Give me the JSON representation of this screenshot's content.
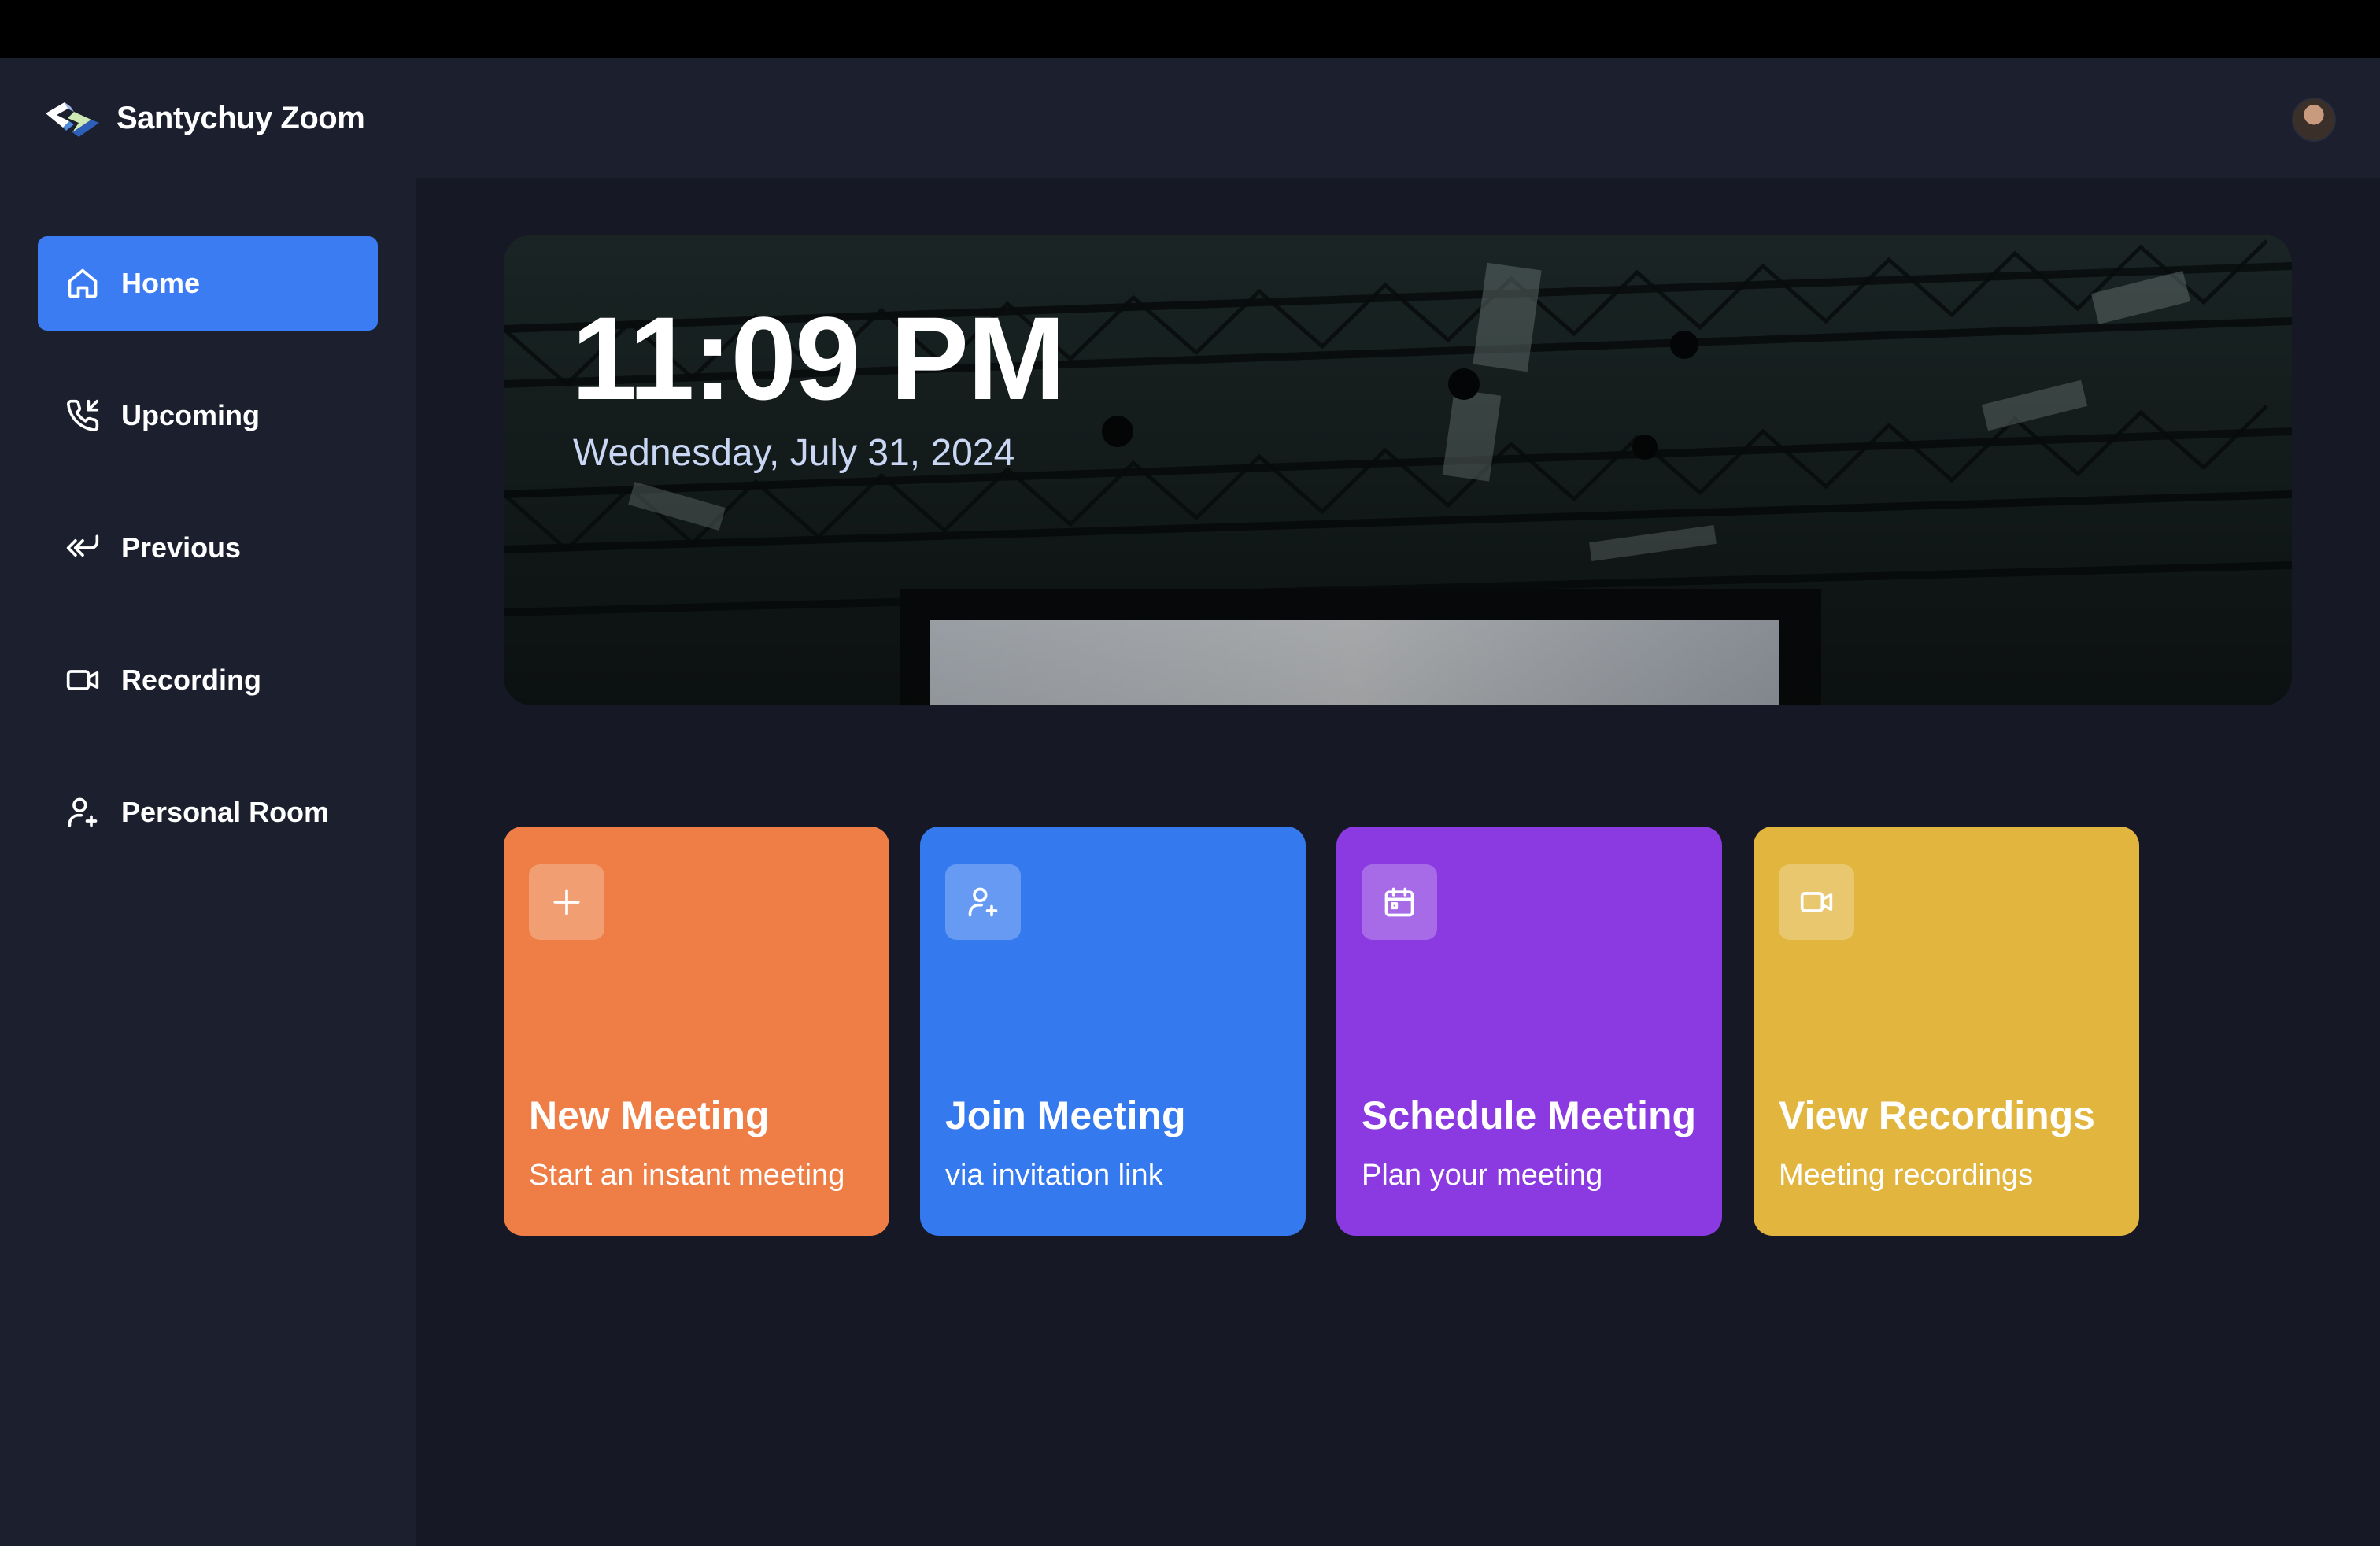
{
  "app": {
    "title": "Santychuy Zoom",
    "logo_icon": "zoom-logo-icon",
    "avatar_icon": "user-avatar"
  },
  "sidebar": {
    "items": [
      {
        "label": "Home",
        "icon": "home-icon",
        "active": true
      },
      {
        "label": "Upcoming",
        "icon": "phone-incoming-icon",
        "active": false
      },
      {
        "label": "Previous",
        "icon": "reply-arrow-icon",
        "active": false
      },
      {
        "label": "Recording",
        "icon": "video-icon",
        "active": false
      },
      {
        "label": "Personal Room",
        "icon": "user-plus-icon",
        "active": false
      }
    ]
  },
  "hero": {
    "time": "11:09 PM",
    "date": "Wednesday, July 31, 2024"
  },
  "cards": [
    {
      "title": "New Meeting",
      "subtitle": "Start an instant meeting",
      "icon": "plus-icon",
      "color": "#ee7e45"
    },
    {
      "title": "Join Meeting",
      "subtitle": "via invitation link",
      "icon": "user-plus-icon",
      "color": "#3579ef"
    },
    {
      "title": "Schedule Meeting",
      "subtitle": "Plan your meeting",
      "icon": "calendar-icon",
      "color": "#8a3ae0"
    },
    {
      "title": "View Recordings",
      "subtitle": "Meeting recordings",
      "icon": "video-icon",
      "color": "#e2b53f"
    }
  ],
  "colors": {
    "accent": "#3b7cf3",
    "sidebar_bg": "#1c1f2e",
    "main_bg": "#161925"
  }
}
